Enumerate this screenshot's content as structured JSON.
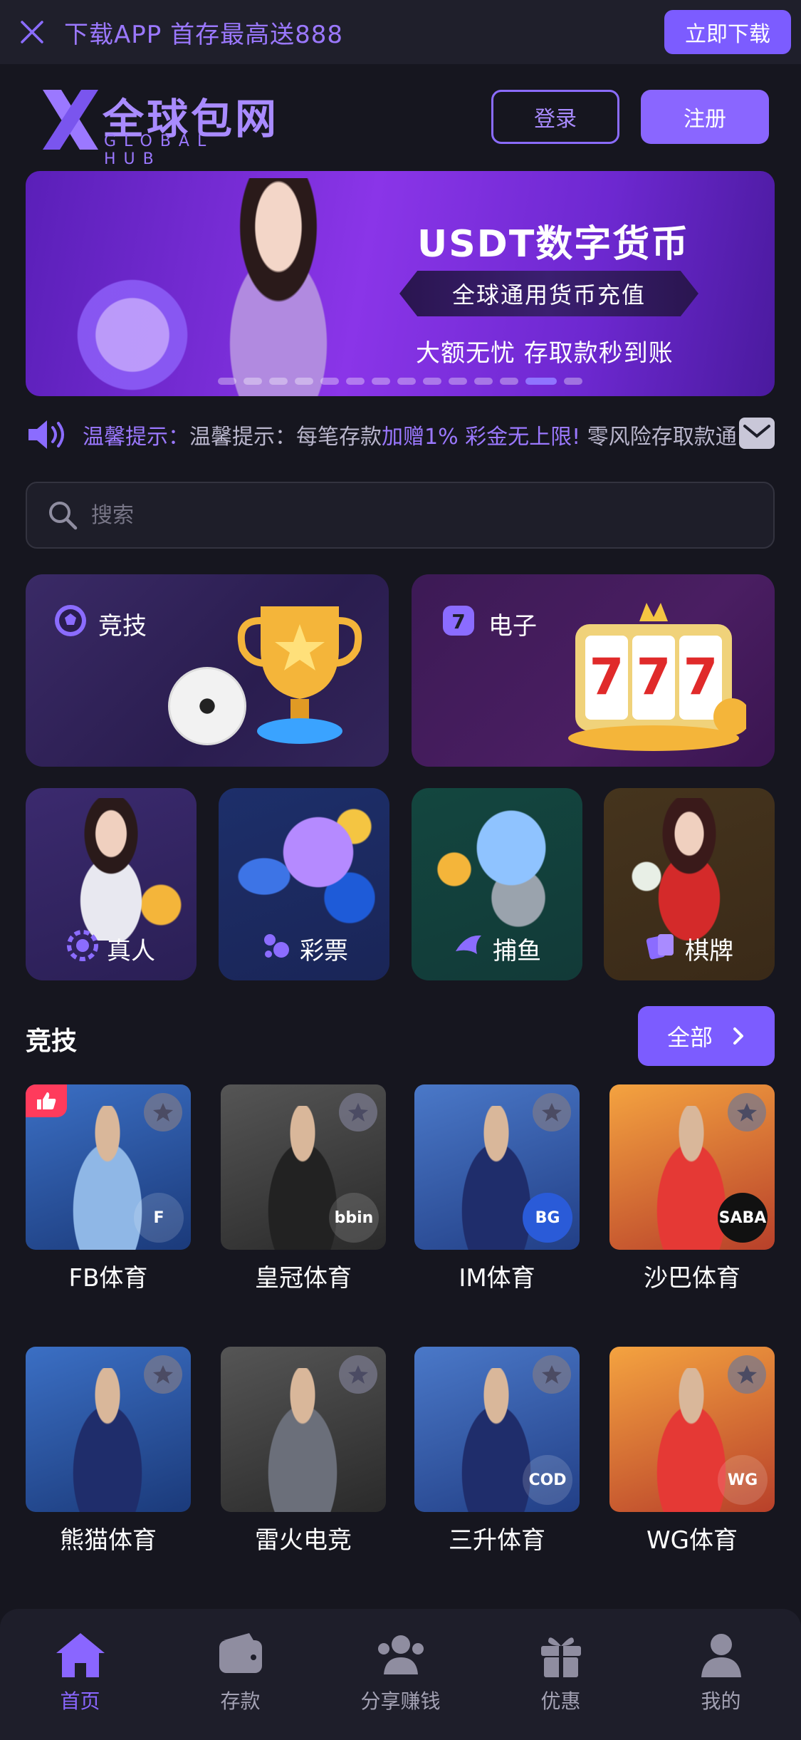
{
  "topbar": {
    "promo": "下载APP 首存最高送888",
    "download_button": "立即下载"
  },
  "header": {
    "logo_cn": "全球包网",
    "logo_en": "GLOBAL HUB",
    "login_button": "登录",
    "register_button": "注册"
  },
  "banner": {
    "title": "USDT数字货币",
    "pill": "全球通用货币充值",
    "subtitle": "大额无忧 存取款秒到账",
    "slide_count": 14,
    "active_slide": 12
  },
  "notice": {
    "prefix": "温馨提示：每笔存款",
    "highlight": "加赠1% 彩金无上限!",
    "suffix": " 零风险存取款通道"
  },
  "search": {
    "placeholder": "搜索"
  },
  "categories_big": [
    {
      "label": "竞技",
      "icon": "soccer-ball-icon"
    },
    {
      "label": "电子",
      "icon": "slot-7-icon"
    }
  ],
  "categories_small": [
    {
      "label": "真人",
      "icon": "chip-icon"
    },
    {
      "label": "彩票",
      "icon": "lottery-icon"
    },
    {
      "label": "捕鱼",
      "icon": "shark-icon"
    },
    {
      "label": "棋牌",
      "icon": "cards-icon"
    }
  ],
  "section": {
    "title": "竞技",
    "all_button": "全部"
  },
  "venues": [
    {
      "name": "FB体育",
      "badge": "F",
      "hot": true,
      "kit": "#8fb7e6"
    },
    {
      "name": "皇冠体育",
      "badge": "bbin",
      "hot": false,
      "kit": "#222222"
    },
    {
      "name": "IM体育",
      "badge": "BG",
      "hot": false,
      "kit": "#1f2d6b"
    },
    {
      "name": "沙巴体育",
      "badge": "SABA",
      "hot": false,
      "kit": "#e53935"
    },
    {
      "name": "熊猫体育",
      "badge": "",
      "hot": false,
      "kit": "#1f2d6b"
    },
    {
      "name": "雷火电竞",
      "badge": "",
      "hot": false,
      "kit": "#6b6f7a"
    },
    {
      "name": "三升体育",
      "badge": "COD",
      "hot": false,
      "kit": "#1f2d6b"
    },
    {
      "name": "WG体育",
      "badge": "WG",
      "hot": false,
      "kit": "#e53935"
    }
  ],
  "bottom_nav": [
    {
      "label": "首页",
      "icon": "home-icon",
      "active": true
    },
    {
      "label": "存款",
      "icon": "wallet-icon",
      "active": false
    },
    {
      "label": "分享赚钱",
      "icon": "users-icon",
      "active": false
    },
    {
      "label": "优惠",
      "icon": "gift-icon",
      "active": false
    },
    {
      "label": "我的",
      "icon": "user-icon",
      "active": false
    }
  ],
  "colors": {
    "accent": "#7c5cff",
    "background": "#16161f",
    "hot": "#ff3b5c"
  }
}
